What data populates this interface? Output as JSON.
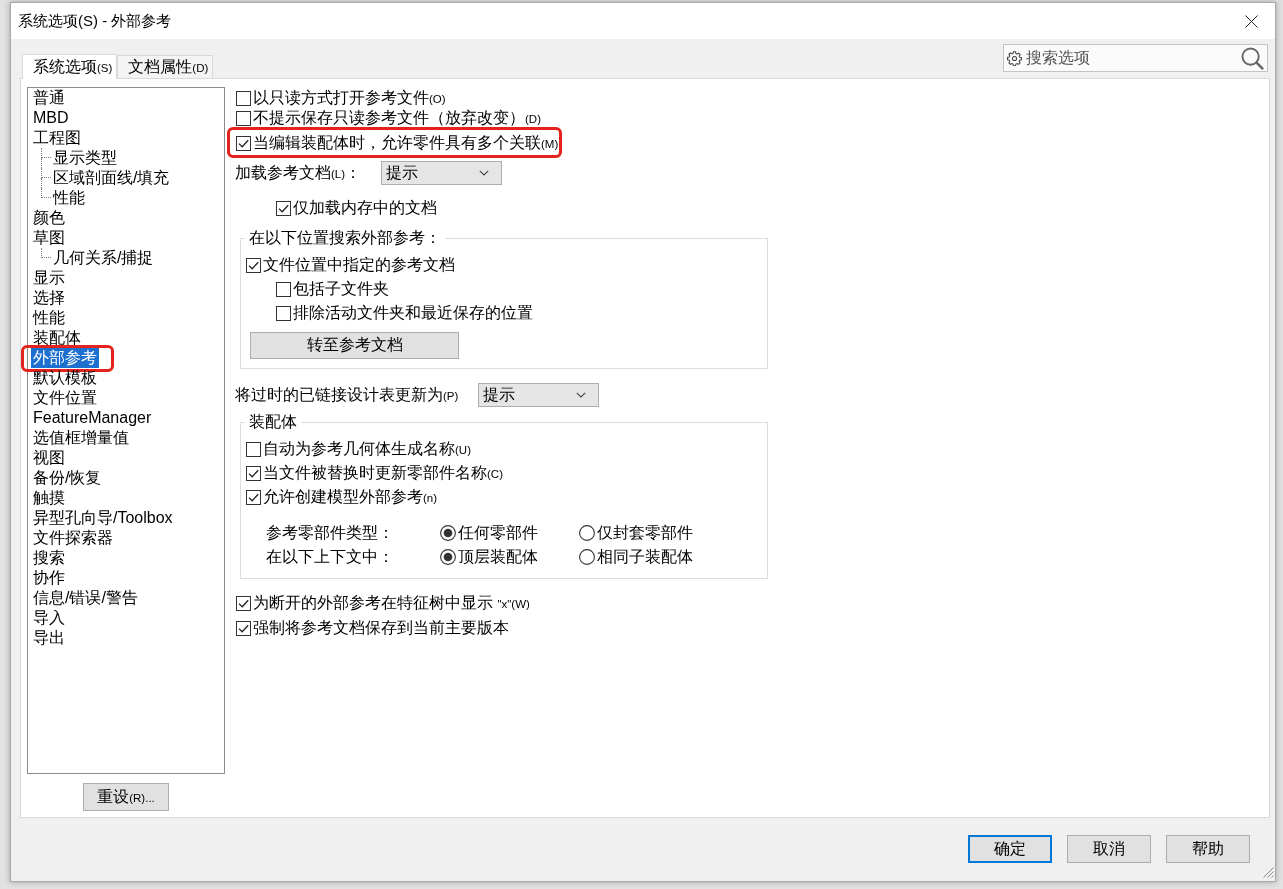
{
  "window": {
    "title": "系统选项(S) - 外部参考"
  },
  "tabs": [
    {
      "label": "系统选项",
      "shortcut": "(S)",
      "selected": true
    },
    {
      "label": "文档属性",
      "shortcut": "(D)",
      "selected": false
    }
  ],
  "search": {
    "placeholder": "搜索选项"
  },
  "sidebar": {
    "items": [
      {
        "label": "普通",
        "selected": false,
        "highlighted": false
      },
      {
        "label": "MBD",
        "selected": false,
        "highlighted": false
      },
      {
        "label": "工程图",
        "selected": false,
        "highlighted": false,
        "children": [
          {
            "label": "显示类型",
            "selected": false,
            "highlighted": false
          },
          {
            "label": "区域剖面线/填充",
            "selected": false,
            "highlighted": false
          },
          {
            "label": "性能",
            "selected": false,
            "highlighted": false
          }
        ]
      },
      {
        "label": "颜色",
        "selected": false,
        "highlighted": false
      },
      {
        "label": "草图",
        "selected": false,
        "highlighted": false,
        "children": [
          {
            "label": "几何关系/捕捉",
            "selected": false,
            "highlighted": false
          }
        ]
      },
      {
        "label": "显示",
        "selected": false,
        "highlighted": false
      },
      {
        "label": "选择",
        "selected": false,
        "highlighted": false
      },
      {
        "label": "性能",
        "selected": false,
        "highlighted": false
      },
      {
        "label": "装配体",
        "selected": false,
        "highlighted": false
      },
      {
        "label": "外部参考",
        "selected": true,
        "highlighted": true
      },
      {
        "label": "默认模板",
        "selected": false,
        "highlighted": false
      },
      {
        "label": "文件位置",
        "selected": false,
        "highlighted": false
      },
      {
        "label": "FeatureManager",
        "selected": false,
        "highlighted": false
      },
      {
        "label": "选值框增量值",
        "selected": false,
        "highlighted": false
      },
      {
        "label": "视图",
        "selected": false,
        "highlighted": false
      },
      {
        "label": "备份/恢复",
        "selected": false,
        "highlighted": false
      },
      {
        "label": "触摸",
        "selected": false,
        "highlighted": false
      },
      {
        "label": "异型孔向导/Toolbox",
        "selected": false,
        "highlighted": false
      },
      {
        "label": "文件探索器",
        "selected": false,
        "highlighted": false
      },
      {
        "label": "搜索",
        "selected": false,
        "highlighted": false
      },
      {
        "label": "协作",
        "selected": false,
        "highlighted": false
      },
      {
        "label": "信息/错误/警告",
        "selected": false,
        "highlighted": false
      },
      {
        "label": "导入",
        "selected": false,
        "highlighted": false
      },
      {
        "label": "导出",
        "selected": false,
        "highlighted": false
      }
    ],
    "reset_button": {
      "label": "重设",
      "shortcut": "(R)..."
    }
  },
  "options": [
    {
      "kind": "checkbox",
      "label": "以只读方式打开参考文件",
      "shortcut": "(O)",
      "checked": false,
      "highlighted": false
    },
    {
      "kind": "checkbox",
      "label": "不提示保存只读参考文件（放弃改变）",
      "shortcut": "(D)",
      "checked": false,
      "highlighted": false
    },
    {
      "kind": "checkbox",
      "label": "当编辑装配体时，允许零件具有多个关联",
      "shortcut": "(M)",
      "checked": true,
      "highlighted": true
    },
    {
      "kind": "dropdown",
      "label": "加载参考文档",
      "shortcut": "(L)",
      "suffix": "：",
      "value": "提示",
      "children": [
        {
          "kind": "checkbox",
          "label": "仅加载内存中的文档",
          "checked": true,
          "highlighted": false
        }
      ]
    },
    {
      "kind": "group",
      "title": "在以下位置搜索外部参考：",
      "items": [
        {
          "kind": "checkbox",
          "label": "文件位置中指定的参考文档",
          "checked": true,
          "highlighted": false,
          "children": [
            {
              "kind": "checkbox",
              "label": "包括子文件夹",
              "checked": false,
              "highlighted": false
            },
            {
              "kind": "checkbox",
              "label": "排除活动文件夹和最近保存的位置",
              "checked": false,
              "highlighted": false
            }
          ]
        },
        {
          "kind": "button",
          "label": "转至参考文档"
        }
      ]
    },
    {
      "kind": "dropdown",
      "label": "将过时的已链接设计表更新为",
      "shortcut": "(P)",
      "value": "提示"
    },
    {
      "kind": "group",
      "title": "装配体",
      "items": [
        {
          "kind": "checkbox",
          "label": "自动为参考几何体生成名称",
          "shortcut": "(U)",
          "checked": false,
          "highlighted": false
        },
        {
          "kind": "checkbox",
          "label": "当文件被替换时更新零部件名称",
          "shortcut": "(C)",
          "checked": true,
          "highlighted": false
        },
        {
          "kind": "checkbox",
          "label": "允许创建模型外部参考",
          "shortcut": "(n)",
          "checked": true,
          "highlighted": false,
          "children": [
            {
              "kind": "radio_row",
              "label": "参考零部件类型：",
              "choices": [
                {
                  "label": "任何零部件",
                  "selected": true
                },
                {
                  "label": "仅封套零部件",
                  "selected": false
                }
              ]
            },
            {
              "kind": "radio_row",
              "label": "在以下上下文中：",
              "choices": [
                {
                  "label": "顶层装配体",
                  "selected": true
                },
                {
                  "label": "相同子装配体",
                  "selected": false
                }
              ]
            }
          ]
        }
      ]
    },
    {
      "kind": "checkbox",
      "label": "为断开的外部参考在特征树中显示 ",
      "shortcut": "\"x\"(W)",
      "checked": true,
      "highlighted": false
    },
    {
      "kind": "checkbox",
      "label": "强制将参考文档保存到当前主要版本",
      "checked": true,
      "highlighted": false
    }
  ],
  "buttons": [
    {
      "label": "确定",
      "default": true
    },
    {
      "label": "取消",
      "default": false
    },
    {
      "label": "帮助",
      "default": false
    }
  ]
}
